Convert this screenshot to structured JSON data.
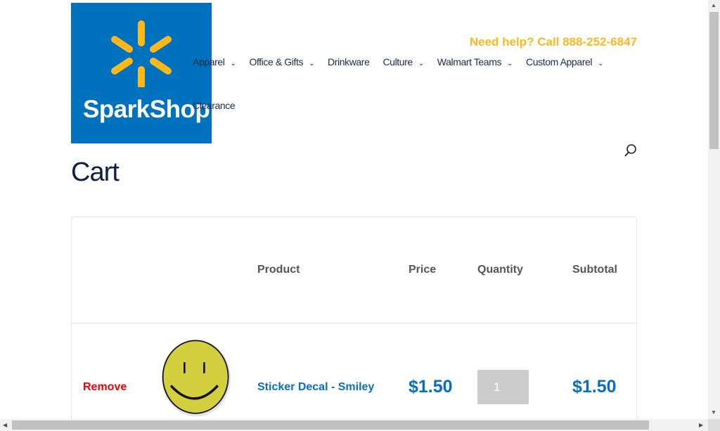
{
  "header": {
    "logo_text": "SparkShop",
    "help_text": "Need help? Call 888-252-6847",
    "nav": [
      {
        "label": "Apparel",
        "dropdown": true
      },
      {
        "label": "Office & Gifts",
        "dropdown": true
      },
      {
        "label": "Drinkware",
        "dropdown": false
      },
      {
        "label": "Culture",
        "dropdown": true
      },
      {
        "label": "Walmart Teams",
        "dropdown": true
      },
      {
        "label": "Custom Apparel",
        "dropdown": true
      }
    ],
    "nav_extra": "Clearance",
    "search_icon": "search-icon"
  },
  "page_title": "Cart",
  "cart": {
    "columns": [
      "Product",
      "Price",
      "Quantity",
      "Subtotal"
    ],
    "items": [
      {
        "remove_label": "Remove",
        "name": "Sticker Decal - Smiley",
        "price": "$1.50",
        "quantity": "1",
        "subtotal": "$1.50"
      }
    ]
  },
  "colors": {
    "brand_blue": "#0071bc",
    "accent_yellow": "#ffb81c",
    "remove_red": "#ee0000",
    "link_blue": "#0a6ebd"
  }
}
